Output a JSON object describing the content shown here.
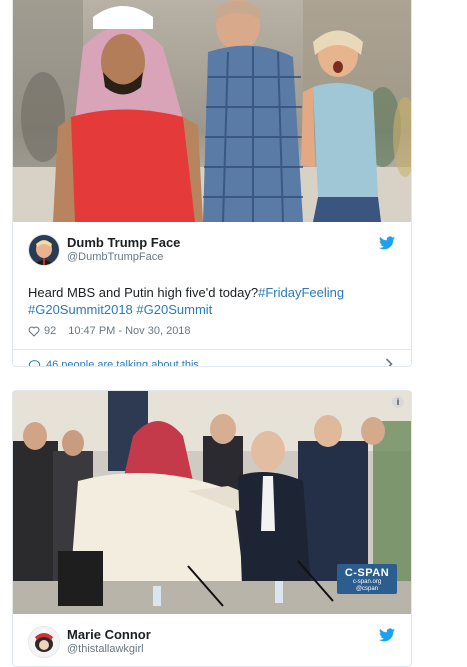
{
  "tweets": [
    {
      "author": {
        "name": "Dumb Trump Face",
        "handle": "@DumbTrumpFace"
      },
      "text": "Heard MBS and Putin high five'd today?",
      "hashtags": [
        "#FridayFeeling",
        "#G20Summit2018",
        "#G20Summit"
      ],
      "likes": "92",
      "timestamp": "10:47 PM - Nov 30, 2018",
      "talking": "46 people are talking about this",
      "icons": {
        "like": "heart-icon",
        "talking": "speech-bubble-icon",
        "brand": "twitter-bird-icon",
        "more": "chevron-right-icon"
      }
    },
    {
      "author": {
        "name": "Marie Connor",
        "handle": "@thistallawkgirl"
      },
      "media_badge": {
        "logo": "C-SPAN",
        "url": "c-span.org",
        "tag": "@cspan"
      },
      "info_badge": "i"
    }
  ],
  "colors": {
    "link": "#2b7bb9",
    "muted": "#697882",
    "text": "#1c2022",
    "border": "#e1e8ed",
    "twitter_blue": "#1da1f2"
  }
}
